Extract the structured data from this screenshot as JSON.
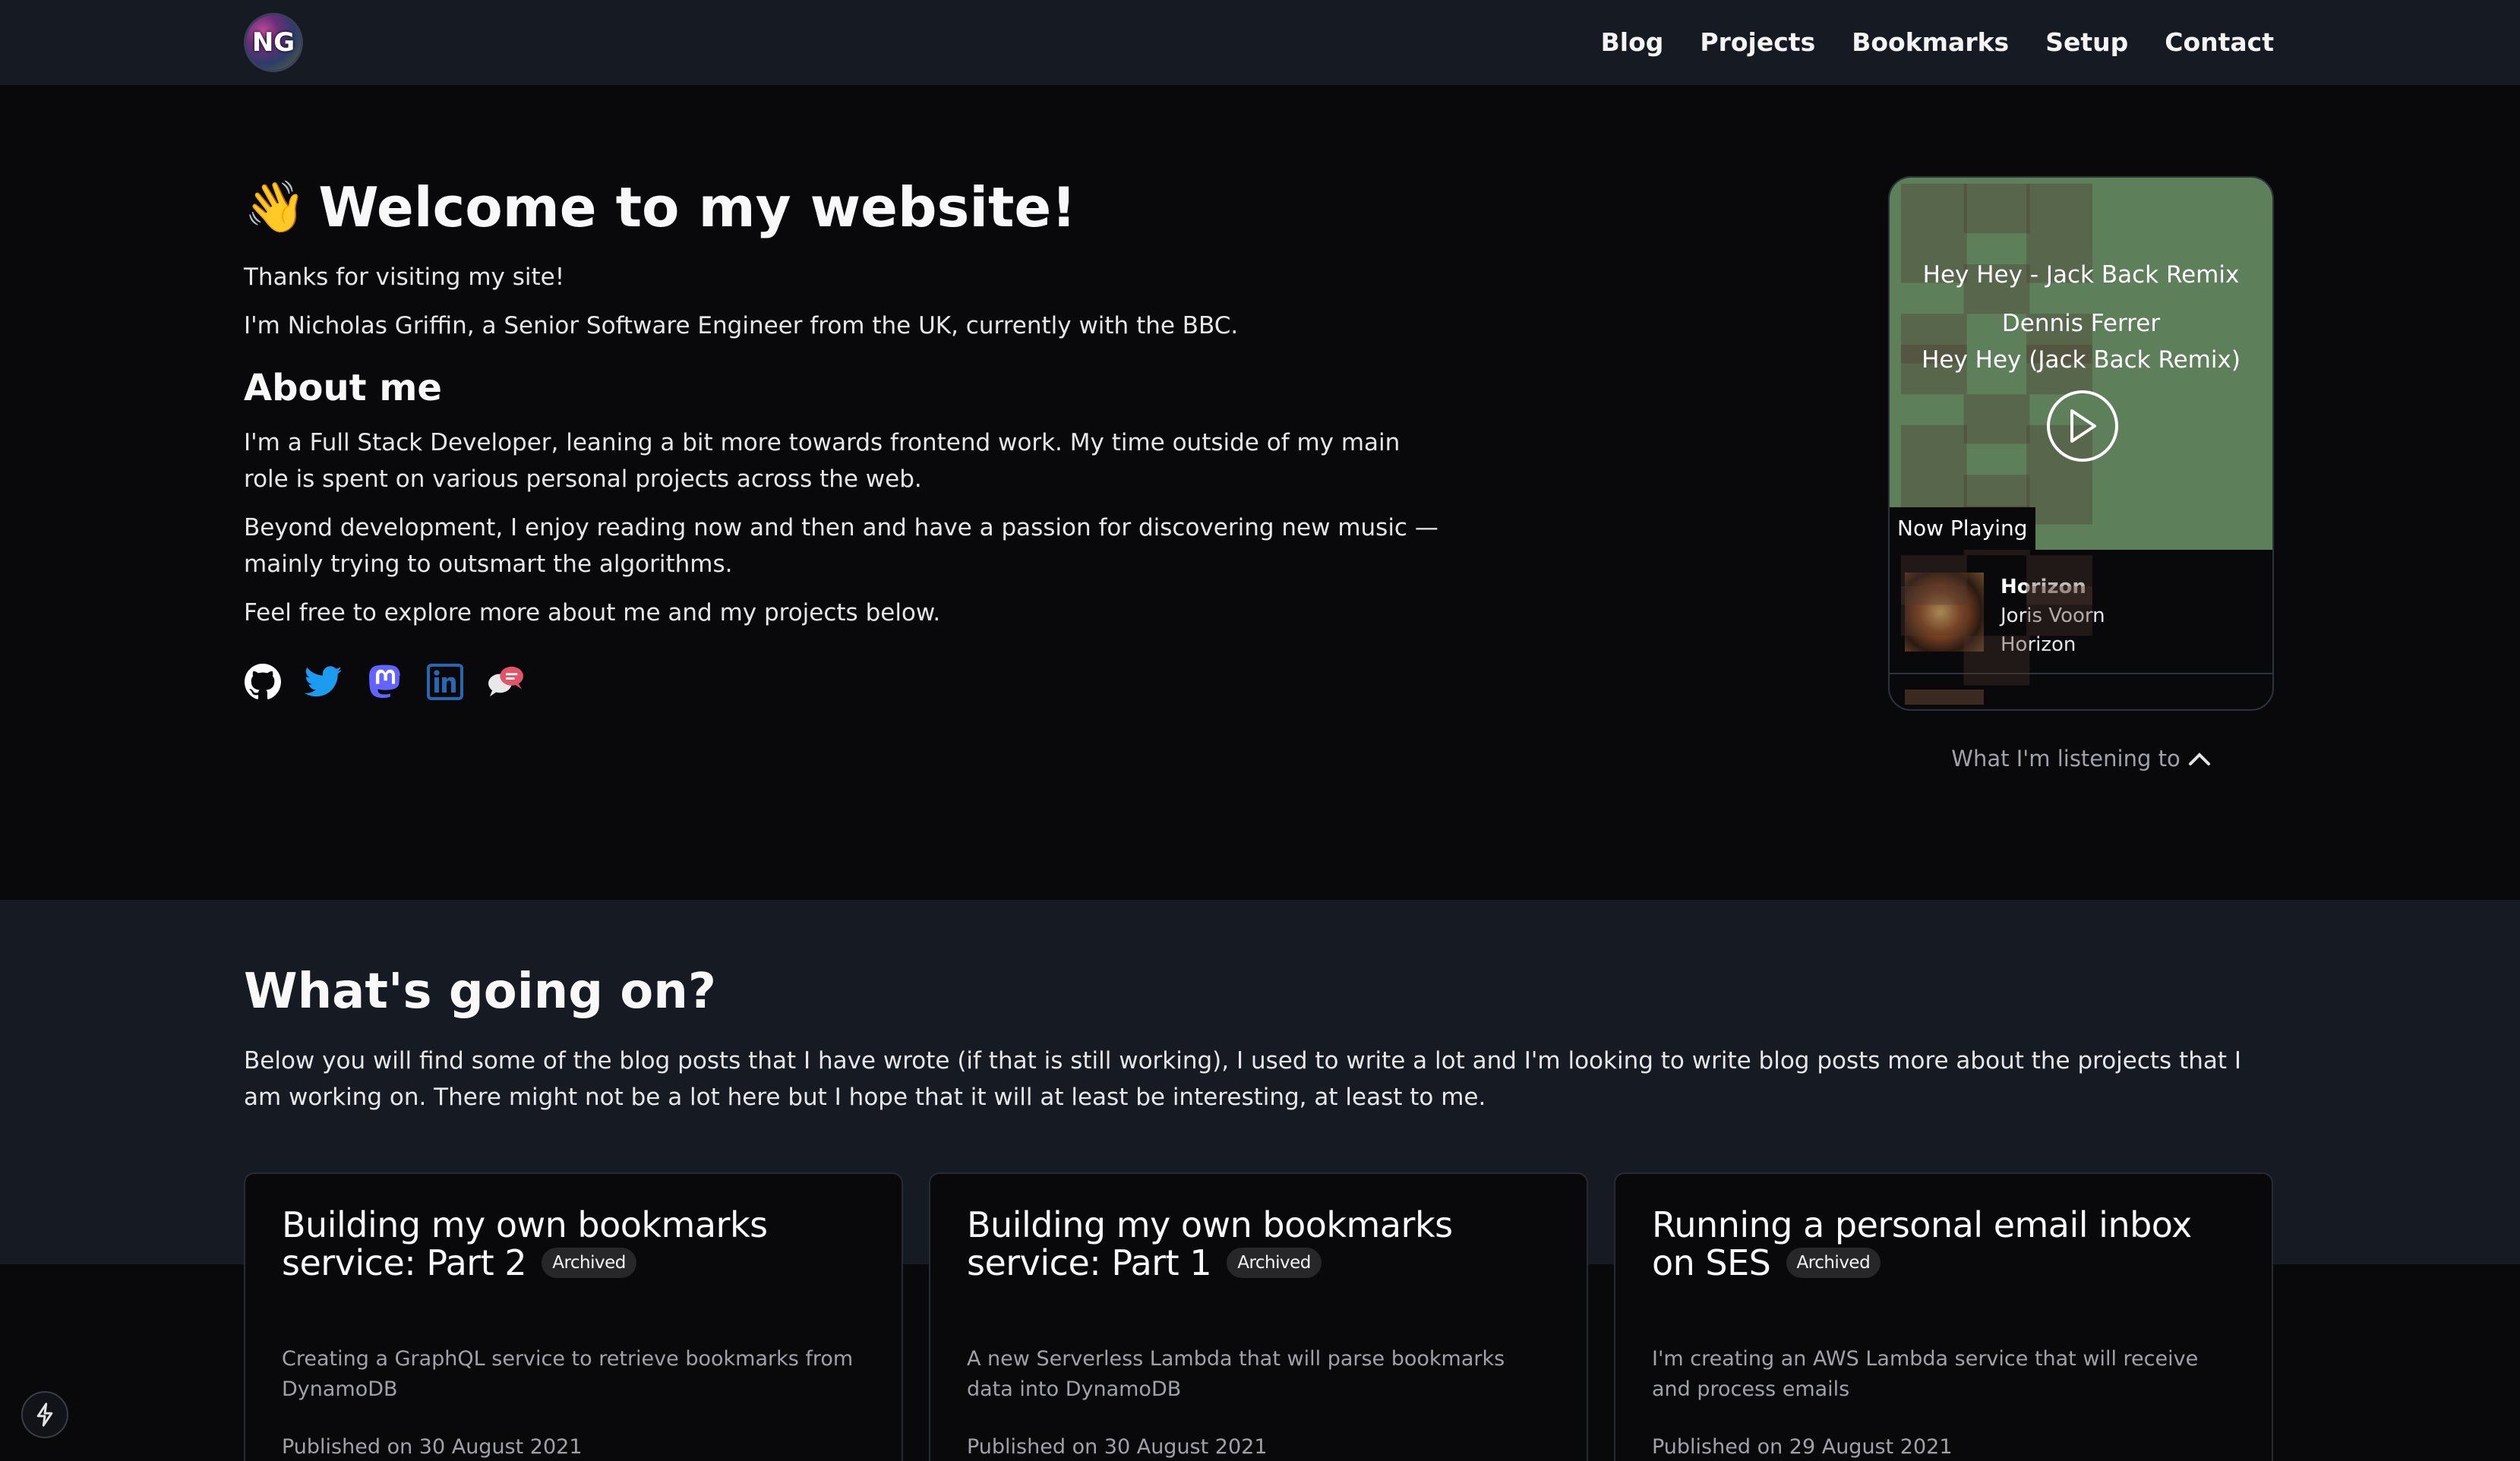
{
  "header": {
    "logo_text": "NG",
    "nav": [
      "Blog",
      "Projects",
      "Bookmarks",
      "Setup",
      "Contact"
    ]
  },
  "hero": {
    "wave_emoji": "👋",
    "title": "Welcome to my website!",
    "intro1": "Thanks for visiting my site!",
    "intro2": "I'm Nicholas Griffin, a Senior Software Engineer from the UK, currently with the BBC.",
    "about_heading": "About me",
    "about1": "I'm a Full Stack Developer, leaning a bit more towards frontend work. My time outside of my main role is spent on various personal projects across the web.",
    "about2": "Beyond development, I enjoy reading now and then and have a passion for discovering new music — mainly trying to outsmart the algorithms.",
    "about3": "Feel free to explore more about me and my projects below.",
    "socials": [
      "github-icon",
      "twitter-icon",
      "mastodon-icon",
      "linkedin-icon",
      "chat-icon"
    ]
  },
  "music": {
    "now_title": "Hey Hey - Jack Back Remix",
    "now_artist": "Dennis Ferrer",
    "now_album": "Hey Hey (Jack Back Remix)",
    "now_label": "Now Playing",
    "tracks": [
      {
        "title": "Horizon",
        "artist": "Joris Voorn",
        "album": "Horizon"
      }
    ],
    "toggle_label": "What I'm listening to"
  },
  "section": {
    "heading": "What's going on?",
    "description": "Below you will find some of the blog posts that I have wrote (if that is still working), I used to write a lot and I'm looking to write blog posts more about the projects that I am working on. There might not be a lot here but I hope that it will at least be interesting, at least to me."
  },
  "posts": [
    {
      "title": "Building my own bookmarks service: Part 2",
      "badge": "Archived",
      "description": "Creating a GraphQL service to retrieve bookmarks from DynamoDB",
      "date": "Published on 30 August 2021"
    },
    {
      "title": "Building my own bookmarks service: Part 1",
      "badge": "Archived",
      "description": "A new Serverless Lambda that will parse bookmarks data into DynamoDB",
      "date": "Published on 30 August 2021"
    },
    {
      "title": "Running a personal email inbox on SES",
      "badge": "Archived",
      "description": "I'm creating an AWS Lambda service that will receive and process emails",
      "date": "Published on 29 August 2021"
    }
  ],
  "colors": {
    "background": "#09090b",
    "header_bg": "#161a23",
    "twitter": "#1d9bf0",
    "mastodon": "#6364ff",
    "linkedin": "#2867b2"
  }
}
